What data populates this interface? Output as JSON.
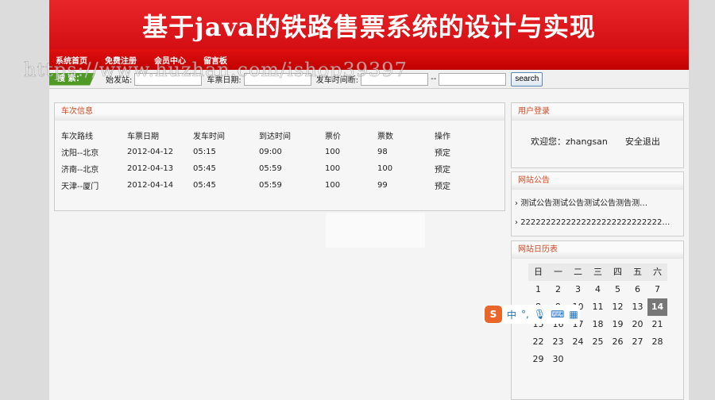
{
  "header": {
    "title": "基于java的铁路售票系统的设计与实现"
  },
  "nav": [
    "系统首页",
    "免费注册",
    "会员中心",
    "留言板"
  ],
  "search": {
    "badge": "搜 索：",
    "from_label": "始发站:",
    "date_label": "车票日期:",
    "time_label": "发车时间断:",
    "sep": "--",
    "button": "search",
    "from": "",
    "date": "",
    "time_from": "",
    "time_to": ""
  },
  "watermark": "https://www.huzhan.com/ishop39397",
  "trains": {
    "title": "车次信息",
    "headers": [
      "车次路线",
      "车票日期",
      "发车时间",
      "到达时间",
      "票价",
      "票数",
      "操作"
    ],
    "rows": [
      [
        "沈阳--北京",
        "2012-04-12",
        "05:15",
        "09:00",
        "100",
        "98",
        "预定"
      ],
      [
        "济南--北京",
        "2012-04-13",
        "05:45",
        "05:59",
        "100",
        "100",
        "预定"
      ],
      [
        "天津--厦门",
        "2012-04-14",
        "05:45",
        "05:59",
        "100",
        "99",
        "预定"
      ]
    ]
  },
  "login": {
    "title": "用户登录",
    "welcome": "欢迎您：zhangsan",
    "logout": "安全退出"
  },
  "notices": {
    "title": "网站公告",
    "items": [
      "测试公告测试公告测试公告测告测…",
      "2222222222222222222222222222…"
    ]
  },
  "calendar": {
    "title": "网站日历表",
    "weekdays": [
      "日",
      "一",
      "二",
      "三",
      "四",
      "五",
      "六"
    ],
    "today": 14,
    "days": 30,
    "first_weekday": 0
  },
  "ime": {
    "lang": "中",
    "punct": "°,"
  },
  "colors": {
    "brand_red": "#d40e12",
    "search_green": "#4f9a24",
    "heading": "#d3461f"
  }
}
